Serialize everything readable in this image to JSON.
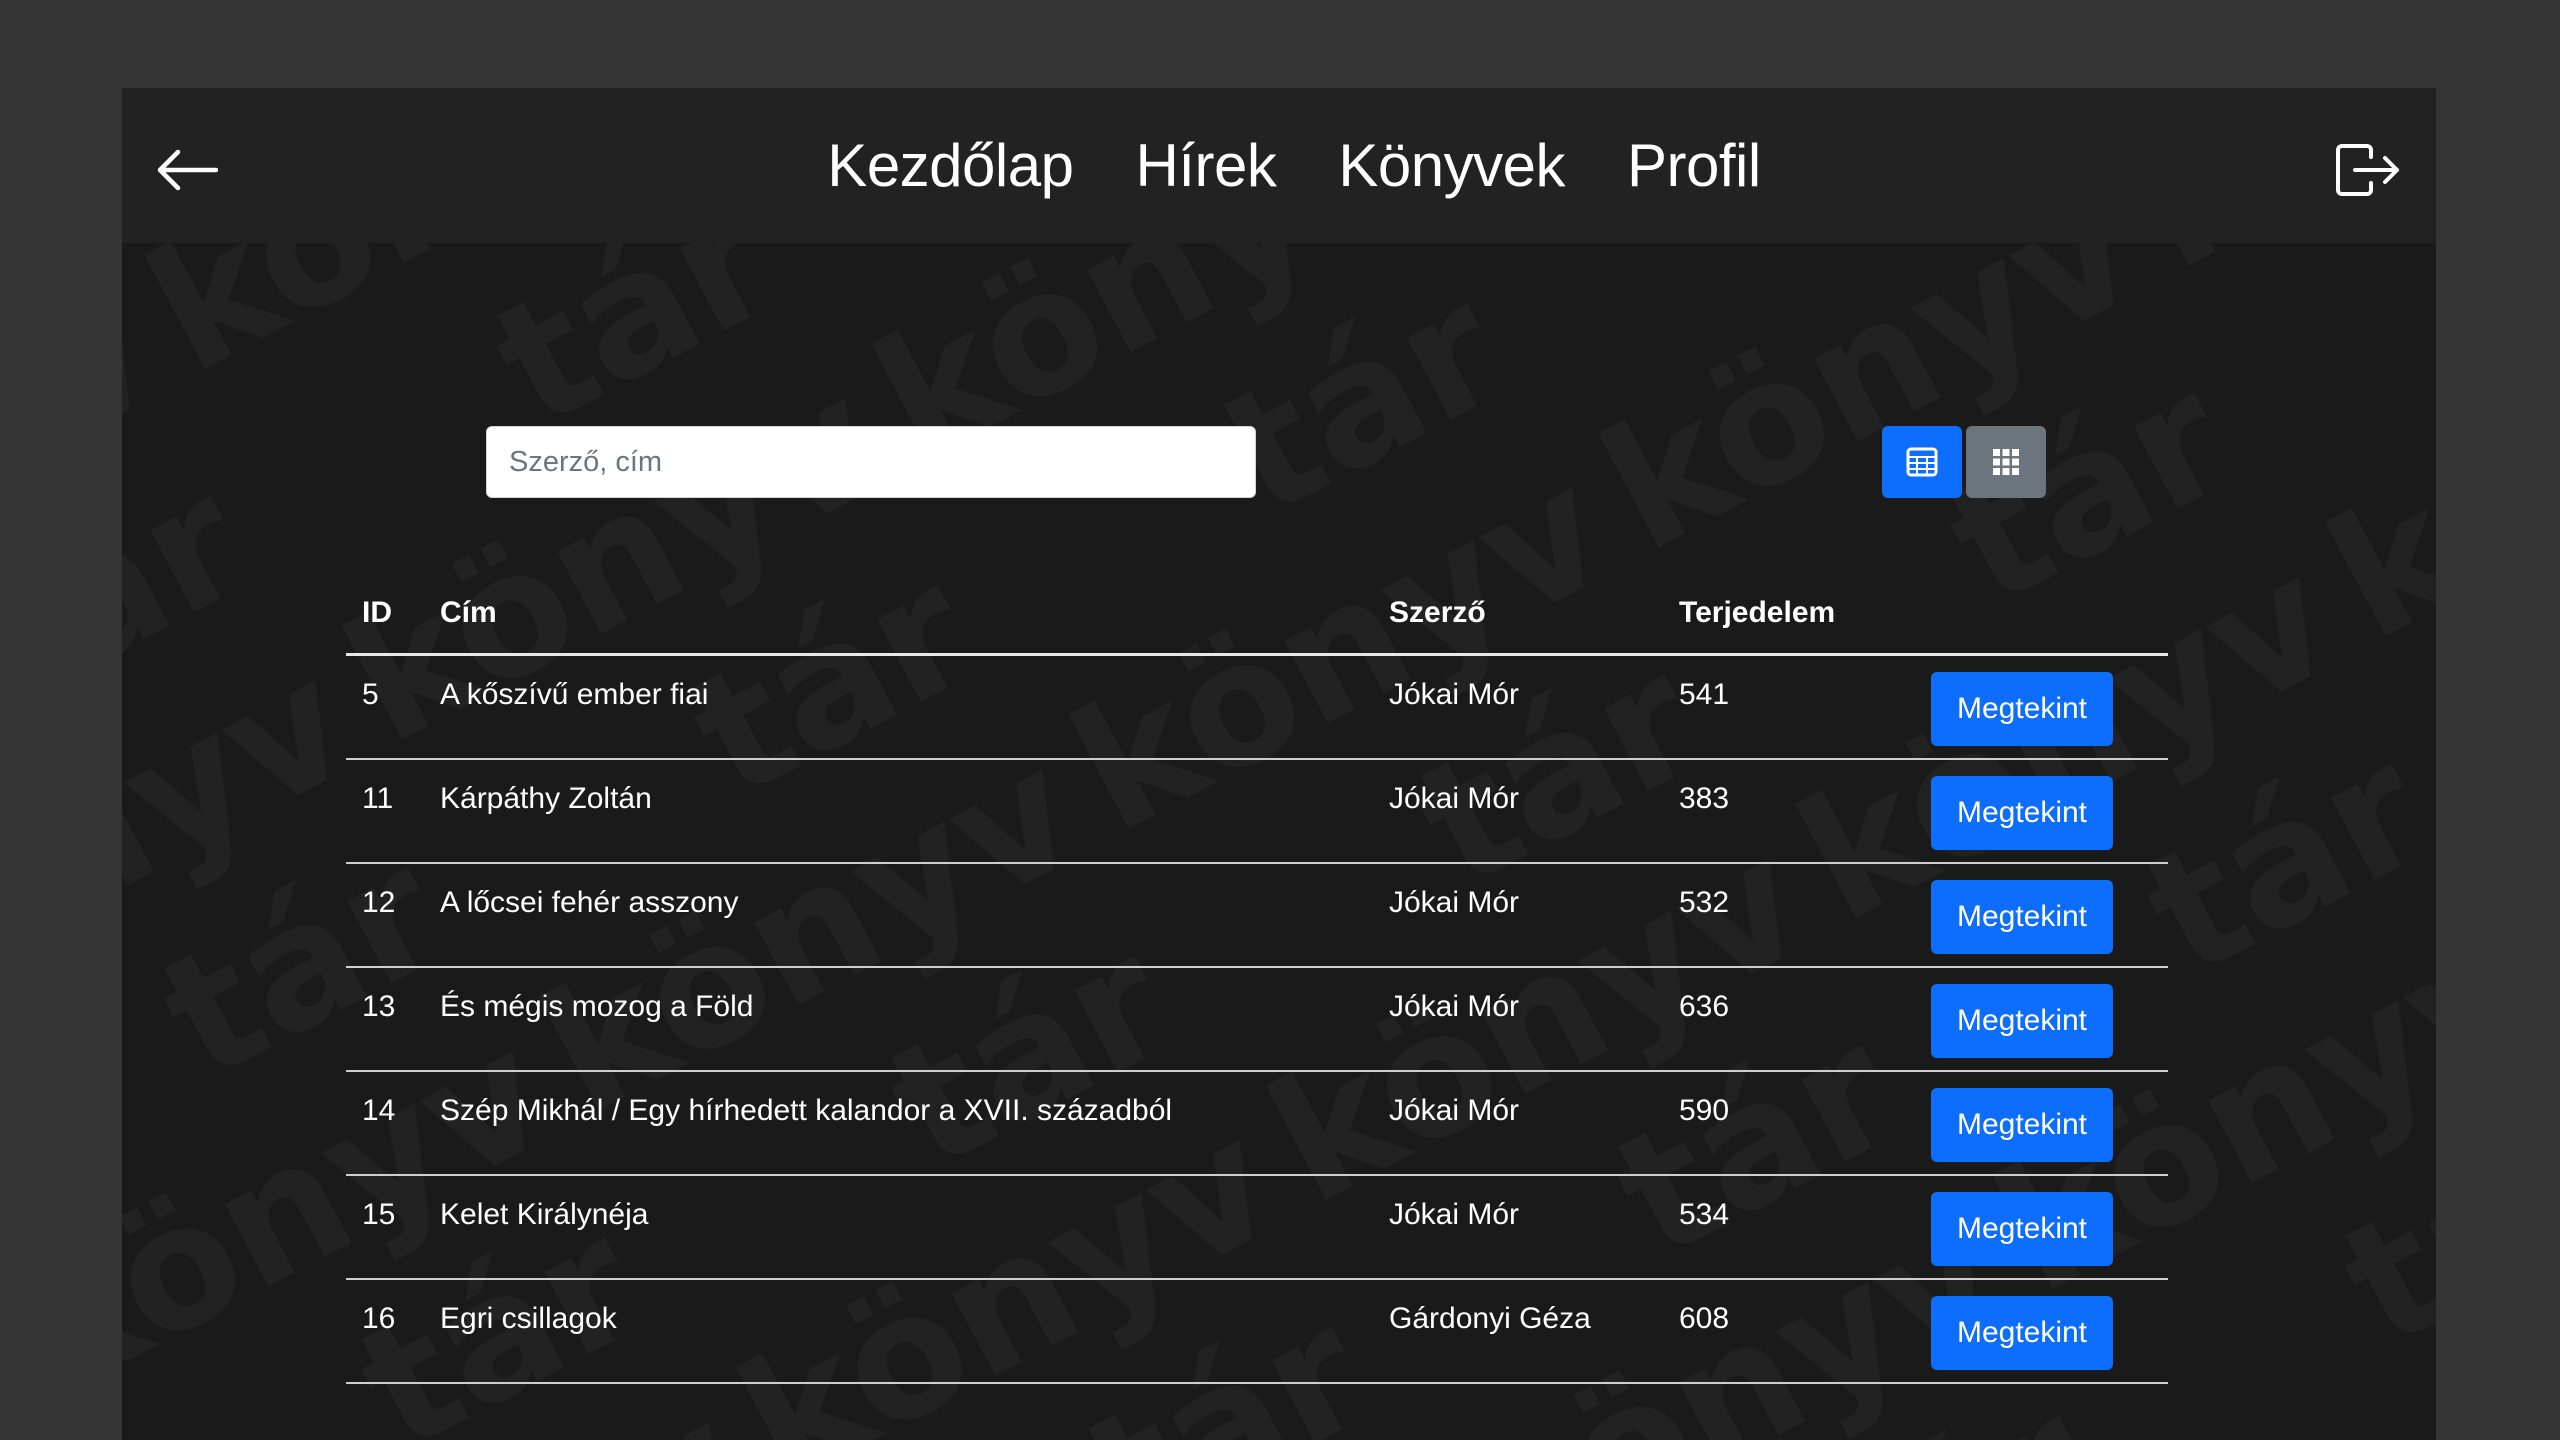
{
  "nav": {
    "links": [
      "Kezdőlap",
      "Hírek",
      "Könyvek",
      "Profil"
    ]
  },
  "search": {
    "placeholder": "Szerző, cím",
    "value": ""
  },
  "table": {
    "headers": {
      "id": "ID",
      "title": "Cím",
      "author": "Szerző",
      "size": "Terjedelem"
    },
    "rows": [
      {
        "id": "5",
        "title": "A kőszívű ember fiai",
        "author": "Jókai Mór",
        "size": "541",
        "action": "Megtekint"
      },
      {
        "id": "11",
        "title": "Kárpáthy Zoltán",
        "author": "Jókai Mór",
        "size": "383",
        "action": "Megtekint"
      },
      {
        "id": "12",
        "title": "A lőcsei fehér asszony",
        "author": "Jókai Mór",
        "size": "532",
        "action": "Megtekint"
      },
      {
        "id": "13",
        "title": "És mégis mozog a Föld",
        "author": "Jókai Mór",
        "size": "636",
        "action": "Megtekint"
      },
      {
        "id": "14",
        "title": "Szép Mikhál / Egy hírhedett kalandor a XVII. századból",
        "author": "Jókai Mór",
        "size": "590",
        "action": "Megtekint"
      },
      {
        "id": "15",
        "title": "Kelet Királynéja",
        "author": "Jókai Mór",
        "size": "534",
        "action": "Megtekint"
      },
      {
        "id": "16",
        "title": "Egri csillagok",
        "author": "Gárdonyi Géza",
        "size": "608",
        "action": "Megtekint"
      }
    ]
  },
  "colors": {
    "primary": "#0d6efd",
    "secondary": "#6c757d",
    "navbar": "#222222",
    "background": "#1a1a1a"
  },
  "icons": {
    "back": "arrow-left-icon",
    "logout": "logout-icon",
    "table_view": "table-view-icon",
    "grid_view": "grid-view-icon"
  }
}
